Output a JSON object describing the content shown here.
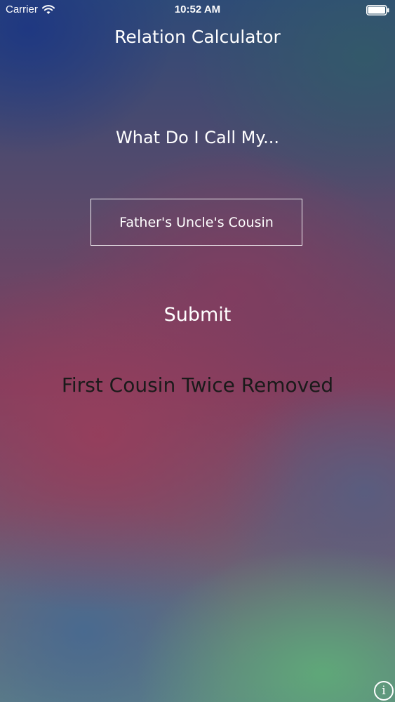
{
  "status_bar": {
    "carrier": "Carrier",
    "time": "10:52 AM",
    "icons": [
      "wifi-icon",
      "battery-icon"
    ]
  },
  "app": {
    "title": "Relation Calculator"
  },
  "main": {
    "prompt": "What Do I Call My...",
    "relation_input_value": "Father's Uncle's Cousin",
    "submit_label": "Submit",
    "result": "First Cousin Twice Removed"
  },
  "info": {
    "icon": "info-icon",
    "glyph": "i"
  },
  "colors": {
    "text": "#ffffff",
    "result_text": "#1a1a1a"
  }
}
